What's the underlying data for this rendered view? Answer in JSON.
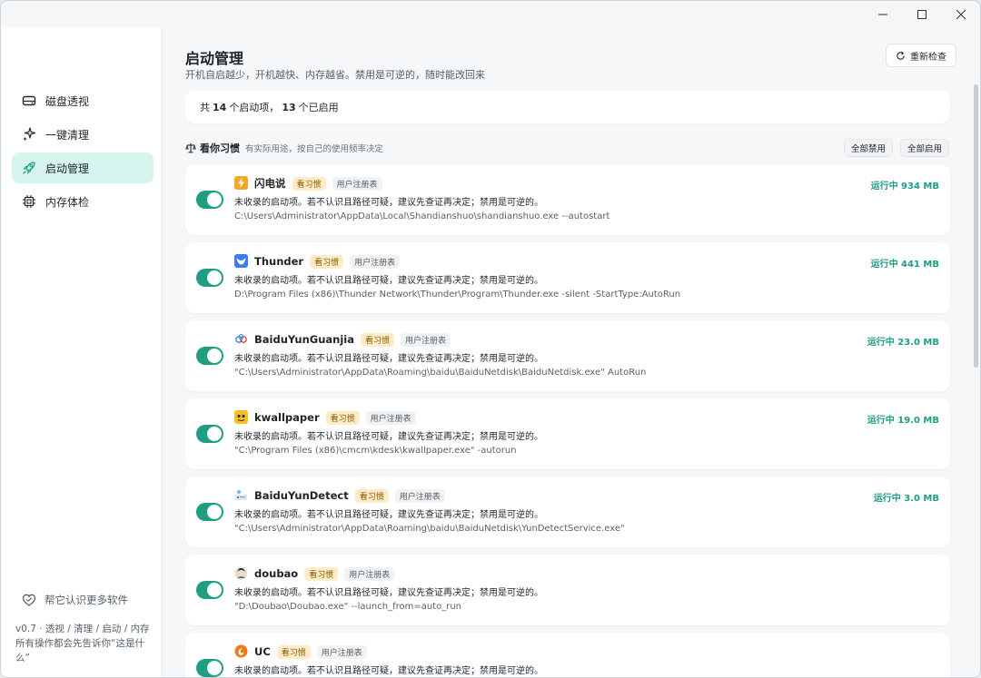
{
  "window": {
    "controls": {
      "minimize": "minimize-icon",
      "maximize": "maximize-icon",
      "close": "close-icon"
    }
  },
  "sidebar": {
    "items": [
      {
        "label": "磁盘透视",
        "icon": "disk-icon",
        "active": false
      },
      {
        "label": "一键清理",
        "icon": "sparkle-icon",
        "active": false
      },
      {
        "label": "启动管理",
        "icon": "rocket-icon",
        "active": true
      },
      {
        "label": "内存体检",
        "icon": "chip-icon",
        "active": false
      }
    ],
    "help_label": "帮它认识更多软件",
    "version_line1": "v0.7 · 透视 / 清理 / 启动 / 内存",
    "version_line2": "所有操作都会先告诉你“这是什么”"
  },
  "header": {
    "title": "启动管理",
    "subtitle": "开机自启越少，开机越快、内存越省。禁用是可逆的，随时能改回来",
    "refresh_label": "重新检查"
  },
  "summary": {
    "prefix": "共",
    "total": "14",
    "middle": "个启动项，",
    "enabled": "13",
    "suffix": "个已启用"
  },
  "section": {
    "title": "看你习惯",
    "desc": "有实际用途，按自己的使用频率决定",
    "disable_all": "全部禁用",
    "enable_all": "全部启用"
  },
  "colors": {
    "accent": "#1f9e83",
    "active_nav": "#d6f5ee",
    "habit_badge_bg": "#fdecc8"
  },
  "items": [
    {
      "name": "闪电说",
      "habit": "看习惯",
      "source": "用户注册表",
      "status": "运行中 934 MB",
      "desc": "未收录的启动项。若不认识且路径可疑，建议先查证再决定；禁用是可逆的。",
      "path": "C:\\Users\\Administrator\\AppData\\Local\\Shandianshuo\\shandianshuo.exe --autostart",
      "icon": "lightning-icon",
      "enabled": true
    },
    {
      "name": "Thunder",
      "habit": "看习惯",
      "source": "用户注册表",
      "status": "运行中 441 MB",
      "desc": "未收录的启动项。若不认识且路径可疑，建议先查证再决定；禁用是可逆的。",
      "path": "D:\\Program Files (x86)\\Thunder Network\\Thunder\\Program\\Thunder.exe -silent -StartType:AutoRun",
      "icon": "bird-icon",
      "enabled": true
    },
    {
      "name": "BaiduYunGuanjia",
      "habit": "看习惯",
      "source": "用户注册表",
      "status": "运行中 23.0 MB",
      "desc": "未收录的启动项。若不认识且路径可疑，建议先查证再决定；禁用是可逆的。",
      "path": "\"C:\\Users\\Administrator\\AppData\\Roaming\\baidu\\BaiduNetdisk\\BaiduNetdisk.exe\" AutoRun",
      "icon": "cloud-icon",
      "enabled": true
    },
    {
      "name": "kwallpaper",
      "habit": "看习惯",
      "source": "用户注册表",
      "status": "运行中 19.0 MB",
      "desc": "未收录的启动项。若不认识且路径可疑，建议先查证再决定；禁用是可逆的。",
      "path": "\"C:\\Program Files (x86)\\cmcm\\kdesk\\kwallpaper.exe\" -autorun",
      "icon": "wallpaper-icon",
      "enabled": true
    },
    {
      "name": "BaiduYunDetect",
      "habit": "看习惯",
      "source": "用户注册表",
      "status": "运行中 3.0 MB",
      "desc": "未收录的启动项。若不认识且路径可疑，建议先查证再决定；禁用是可逆的。",
      "path": "\"C:\\Users\\Administrator\\AppData\\Roaming\\baidu\\BaiduNetdisk\\YunDetectService.exe\"",
      "icon": "detect-icon",
      "enabled": true
    },
    {
      "name": "doubao",
      "habit": "看习惯",
      "source": "用户注册表",
      "status": "",
      "desc": "未收录的启动项。若不认识且路径可疑，建议先查证再决定；禁用是可逆的。",
      "path": "\"D:\\Doubao\\Doubao.exe\" --launch_from=auto_run",
      "icon": "avatar-icon",
      "enabled": true
    },
    {
      "name": "UC",
      "habit": "看习惯",
      "source": "用户注册表",
      "status": "",
      "desc": "未收录的启动项。若不认识且路径可疑，建议先查证再决定；禁用是可逆的。",
      "path": "",
      "icon": "uc-icon",
      "enabled": true
    }
  ]
}
